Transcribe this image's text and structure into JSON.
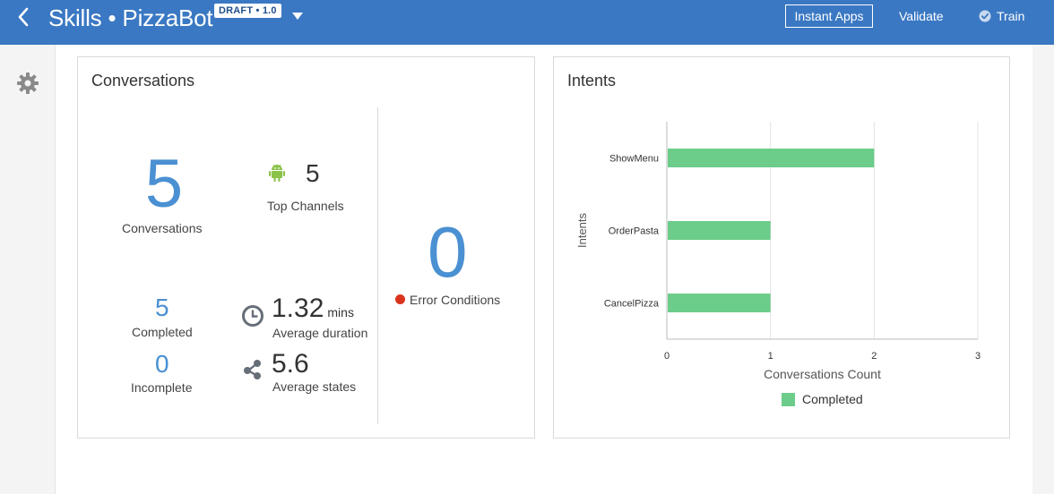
{
  "header": {
    "title": "Skills • PizzaBot",
    "badge": "DRAFT • 1.0",
    "instant_apps": "Instant Apps",
    "validate": "Validate",
    "train": "Train"
  },
  "conversations": {
    "title": "Conversations",
    "total": "5",
    "total_label": "Conversations",
    "top_channels_value": "5",
    "top_channels_label": "Top Channels",
    "completed_value": "5",
    "completed_label": "Completed",
    "incomplete_value": "0",
    "incomplete_label": "Incomplete",
    "avg_duration_value": "1.32",
    "avg_duration_unit": "mins",
    "avg_duration_label": "Average duration",
    "avg_states_value": "5.6",
    "avg_states_label": "Average states",
    "error_value": "0",
    "error_label": "Error Conditions"
  },
  "intents": {
    "title": "Intents"
  },
  "colors": {
    "header_bg": "#3a78c3",
    "accent_blue": "#4a90d2",
    "bar_green": "#6ccc8a",
    "error_red": "#d9331e"
  },
  "icons": [
    "back-icon",
    "dropdown-caret-icon",
    "check-circle-icon",
    "gear-icon",
    "android-icon",
    "clock-icon",
    "share-nodes-icon"
  ],
  "chart_data": {
    "type": "bar",
    "orientation": "horizontal",
    "categories": [
      "ShowMenu",
      "OrderPasta",
      "CancelPizza"
    ],
    "series": [
      {
        "name": "Completed",
        "values": [
          2,
          1,
          1
        ]
      }
    ],
    "xlabel": "Conversations Count",
    "ylabel": "Intents",
    "xlim": [
      0,
      3
    ],
    "xticks": [
      "0",
      "1",
      "2",
      "3"
    ],
    "grid": true,
    "legend": "bottom"
  }
}
